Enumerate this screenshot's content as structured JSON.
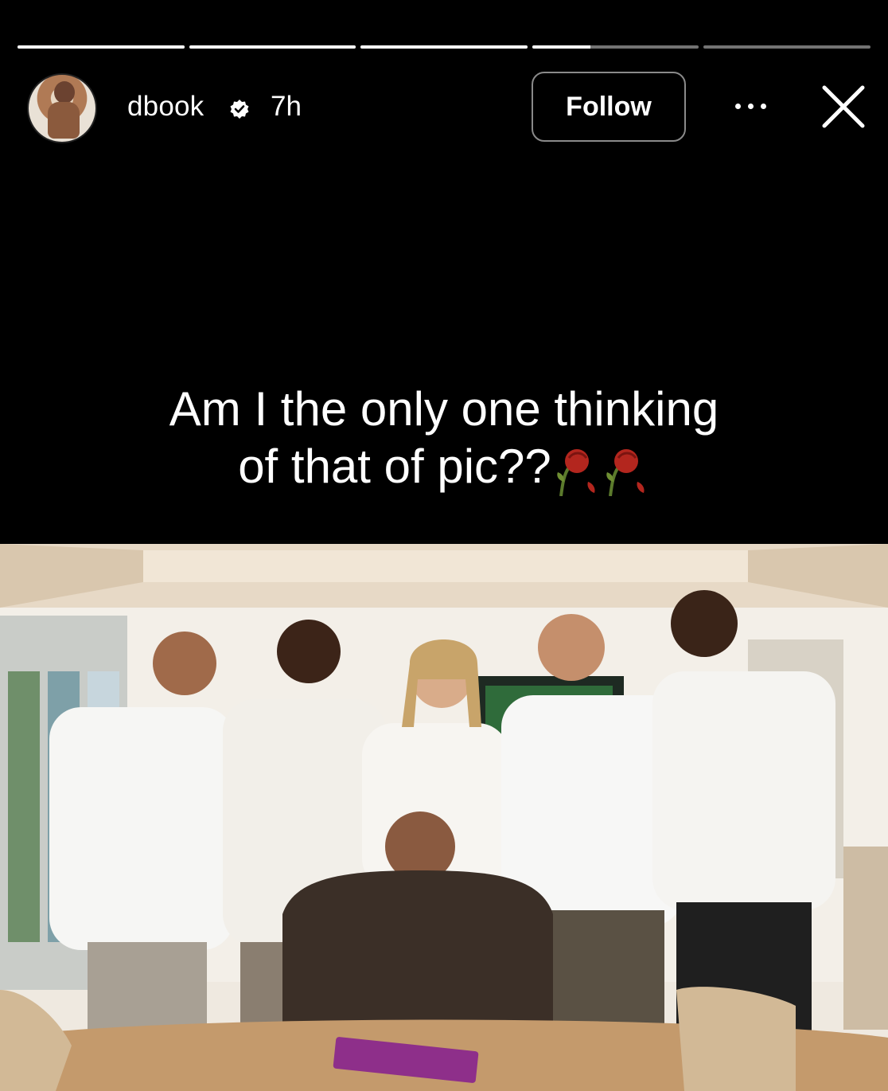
{
  "story": {
    "progress": [
      1,
      1,
      1,
      0.35,
      0
    ],
    "user": {
      "username": "dbook",
      "time": "7h",
      "verified": true
    },
    "follow_label": "Follow",
    "more_icon": "more-horizontal-icon",
    "close_icon": "close-icon",
    "caption_line1": "Am I the only one thinking",
    "caption_line2": "of that of pic??",
    "caption_emoji": "wilted-rose-icon",
    "photo_icon": "group-photo",
    "colors": {
      "background": "#000000",
      "text": "#ffffff",
      "accent_rose": "#b3261e"
    }
  }
}
